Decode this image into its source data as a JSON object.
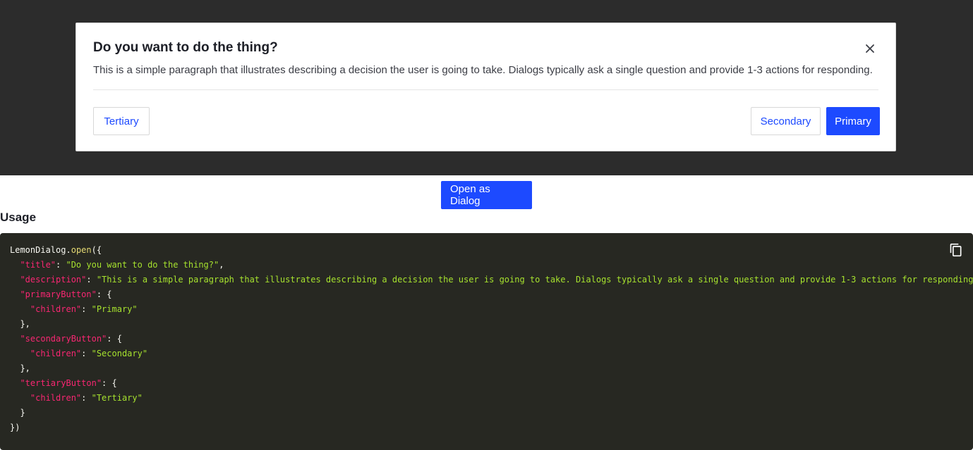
{
  "dialog": {
    "title": "Do you want to do the thing?",
    "description": "This is a simple paragraph that illustrates describing a decision the user is going to take. Dialogs typically ask a single question and provide 1-3 actions for responding.",
    "close_icon": "close-icon",
    "tertiary_label": "Tertiary",
    "secondary_label": "Secondary",
    "primary_label": "Primary"
  },
  "page": {
    "open_button_label": "Open as Dialog",
    "usage_label": "Usage",
    "copy_icon": "copy-icon"
  },
  "code": {
    "obj": "LemonDialog",
    "dot": ".",
    "fn": "open",
    "open_paren": "({",
    "title_key": "\"title\"",
    "title_val": "\"Do you want to do the thing?\"",
    "desc_key": "\"description\"",
    "desc_val": "\"This is a simple paragraph that illustrates describing a decision the user is going to take. Dialogs typically ask a single question and provide 1-3 actions for responding. \"",
    "primary_key": "\"primaryButton\"",
    "secondary_key": "\"secondaryButton\"",
    "tertiary_key": "\"tertiaryButton\"",
    "children_key": "\"children\"",
    "primary_val": "\"Primary\"",
    "secondary_val": "\"Secondary\"",
    "tertiary_val": "\"Tertiary\"",
    "colon": ": ",
    "comma": ",",
    "open_brace": "{",
    "close_brace_comma": "},",
    "close_brace": "}",
    "close_all": "})"
  },
  "colors": {
    "accent": "#1d4aff",
    "overlay": "#2c2c2c",
    "code_bg": "#272822",
    "code_key": "#f92672",
    "code_string": "#a6e22e"
  }
}
